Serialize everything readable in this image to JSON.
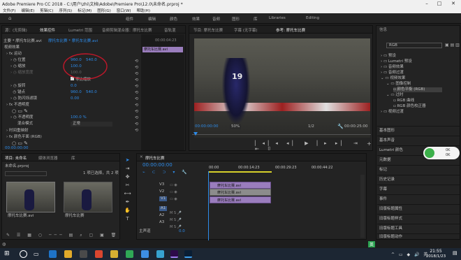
{
  "window": {
    "title": "Adobe Premiere Pro CC 2018 - C:\\用户\\zhi\\文档\\Adobe\\Premiere Pro\\12.0\\未命名.prproj *"
  },
  "menu": [
    "文件(F)",
    "编辑(E)",
    "剪辑(C)",
    "序列(S)",
    "标记(M)",
    "图形(G)",
    "窗口(W)",
    "帮助(H)"
  ],
  "workspaces": [
    "组件",
    "编辑",
    "颜色",
    "效果",
    "音频",
    "图形",
    "库",
    "Libraries",
    "Editing"
  ],
  "effect_controls": {
    "tabs": [
      "源：(无剪辑)",
      "效果控件",
      "Lumetri 范围",
      "音频剪辑混合器：摩托车比赛",
      "音轨混"
    ],
    "header_left": "主要 * 摩托车比赛.avi",
    "header_right": "摩托车比赛 * 摩托车比赛.avi",
    "section": "视频效果",
    "motion": "运动",
    "position_label": "位置",
    "position_x": "960.0",
    "position_y": "540.0",
    "scale_label": "缩放",
    "scale_value": "100.0",
    "scale_width_label": "缩放宽度",
    "scale_width_value": "100.0",
    "uniform_scale": "等比缩放",
    "rotation_label": "旋转",
    "rotation_value": "0.0",
    "anchor_label": "锚点",
    "anchor_x": "960.0",
    "anchor_y": "540.0",
    "flicker_label": "防闪烁滤镜",
    "flicker_value": "0.00",
    "opacity": "不透明度",
    "opacity_label": "不透明度",
    "opacity_value": "100.0 %",
    "blend_label": "混合模式",
    "blend_value": "正常",
    "time_remap": "时间重映射",
    "video_plane": "颜色平面 (RGB)",
    "timecode": "00:00:00:00",
    "clip_name": "摩托车比赛.avi",
    "time_ruler": "00:00:04:23"
  },
  "program": {
    "tabs": [
      "节目: 摩托车比赛",
      "字幕 (无字幕)",
      "参考: 摩托车比赛"
    ],
    "timecode": "00:00:00:00",
    "zoom": "50%",
    "fraction": "1/2",
    "duration": "00:00:25:00",
    "bike_number": "19"
  },
  "project": {
    "tabs": [
      "项目: 未命名",
      "媒体浏览器",
      "库"
    ],
    "file_name": "未命名.prproj",
    "selection": "1 项已选择，共 2 项",
    "items": [
      "摩托车比赛.avi",
      "摩托车比赛"
    ]
  },
  "timeline": {
    "tab": "摩托车比赛",
    "timecode": "00:00:00:00",
    "ruler": [
      "00:00",
      "00:00:14:23",
      "00:00:29:23",
      "00:00:44:22"
    ],
    "tracks": [
      "V3",
      "V2",
      "V1",
      "A1",
      "A2",
      "A3"
    ],
    "master": "主声道",
    "master_value": "0.0",
    "clips": [
      "摩托车比赛.avi",
      "摩托车比赛.avi",
      "摩托车比赛.avi"
    ]
  },
  "right_panel": {
    "title": "信息",
    "search_value": "RGB",
    "tree": [
      "预设",
      "Lumetri 预设",
      "音频效果",
      "音频过渡",
      "视频效果",
      "图像控制",
      "颜色平衡 (RGB)",
      "过时",
      "RGB 曲线",
      "RGB 颜色校正器",
      "视频过渡"
    ],
    "items": [
      "基本图形",
      "基本声音",
      "Lumetri 颜色",
      "元数据",
      "标记",
      "历史记录",
      "字幕",
      "事件",
      "旧版标题属性",
      "旧版标题样式",
      "旧版标题工具",
      "旧版标题动作"
    ]
  },
  "taskbar": {
    "time": "21:55",
    "date": "2018/1/23",
    "ime": "英",
    "pct": "0K",
    "pct2": "0K"
  }
}
